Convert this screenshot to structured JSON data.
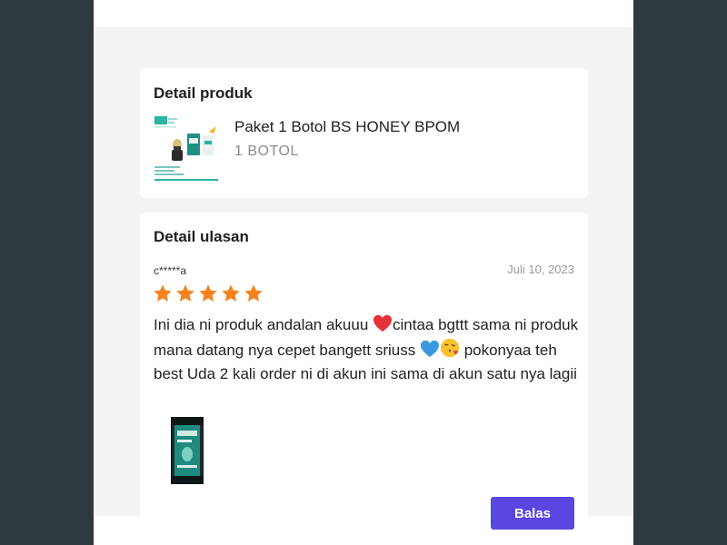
{
  "product_card": {
    "title": "Detail produk",
    "product_name": "Paket 1 Botol BS HONEY BPOM",
    "variant": "1 BOTOL"
  },
  "review_card": {
    "title": "Detail ulasan",
    "reviewer": "c*****a",
    "date": "Juli 10, 2023",
    "rating": 5,
    "rating_max": 5,
    "star_color": "#f5821f",
    "text_part1": "Ini dia ni produk andalan akuuu ",
    "text_part2": "cintaa bgttt sama ni produk mana datang nya cepet bangett sriuss ",
    "text_part3": " pokonyaa teh best Uda 2 kali order ni di akun ini sama di akun satu nya lagii",
    "emojis": [
      "red-heart",
      "blue-heart",
      "face-blowing-kiss"
    ],
    "reply_label": "Balas",
    "reply_color": "#5a46e0"
  }
}
